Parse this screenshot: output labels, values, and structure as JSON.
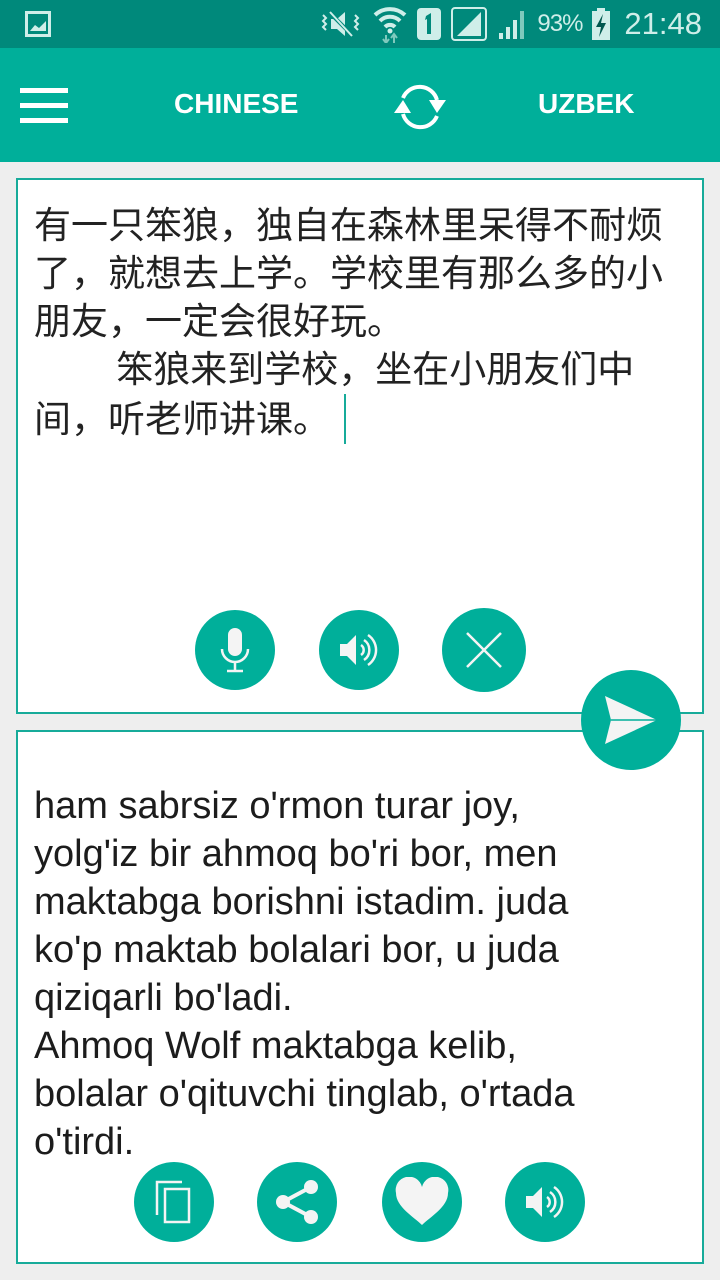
{
  "status_bar": {
    "icons": [
      "gallery-icon",
      "vibrate-mute-icon",
      "wifi-icon",
      "sim-1-icon",
      "signal-icon",
      "signal-icon-2",
      "battery-charging-icon"
    ],
    "battery": "93%",
    "time": "21:48"
  },
  "app_bar": {
    "menu_icon": "hamburger-menu-icon",
    "source_language": "CHINESE",
    "swap_icon": "swap-arrows-icon",
    "target_language": "UZBEK"
  },
  "source": {
    "text": "有一只笨狼，独自在森林里呆得不耐烦了，就想去上学。学校里有那么多的小朋友，一定会很好玩。\n        笨狼来到学校，坐在小朋友们中间，听老师讲课。",
    "buttons": [
      {
        "name": "microphone",
        "icon": "microphone-icon"
      },
      {
        "name": "speak",
        "icon": "speaker-icon"
      },
      {
        "name": "clear",
        "icon": "close-icon"
      }
    ]
  },
  "send_button": {
    "icon": "send-icon"
  },
  "target": {
    "text": "ham sabrsiz o'rmon turar joy,\nyolg'iz bir ahmoq bo'ri bor, men\nmaktabga borishni istadim. juda\nko'p maktab bolalari bor, u juda\nqiziqarli bo'ladi.\nAhmoq Wolf maktabga kelib,\nbolalar o'qituvchi tinglab, o'rtada\no'tirdi.",
    "buttons": [
      {
        "name": "copy",
        "icon": "copy-icon"
      },
      {
        "name": "share",
        "icon": "share-icon"
      },
      {
        "name": "favorite",
        "icon": "heart-icon"
      },
      {
        "name": "speak",
        "icon": "speaker-icon"
      }
    ]
  },
  "colors": {
    "status_bar": "#00897b",
    "accent": "#00af9a",
    "border": "#17ab9a",
    "background": "#eeeeee"
  }
}
